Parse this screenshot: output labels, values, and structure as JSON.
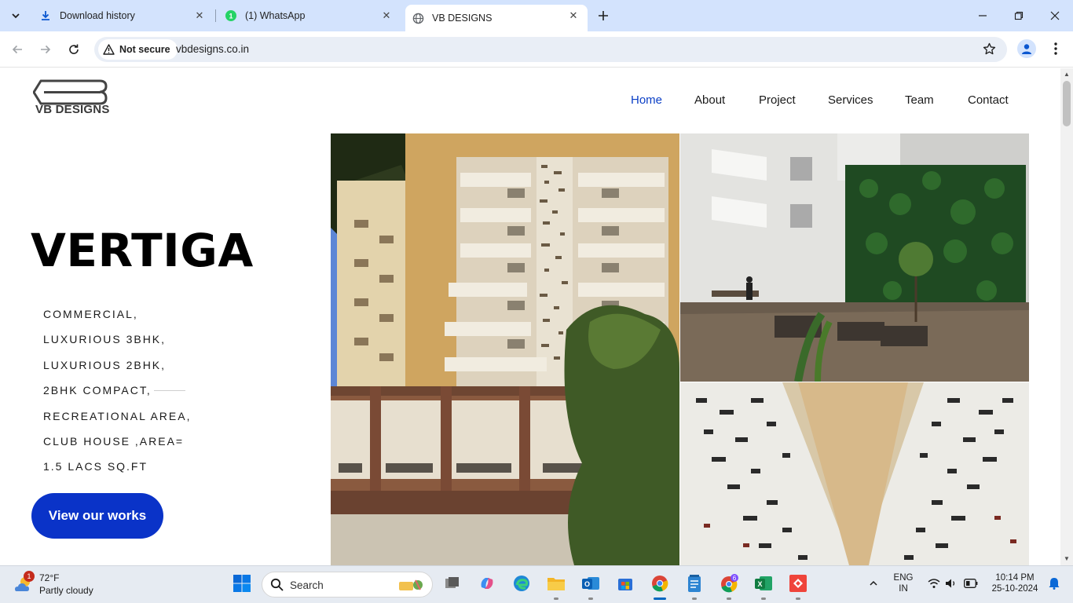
{
  "browser": {
    "tabs": [
      {
        "title": "Download history",
        "icon": "download-icon"
      },
      {
        "title": "(1) WhatsApp",
        "icon": "whatsapp-icon"
      },
      {
        "title": "VB DESIGNS",
        "icon": "globe-icon",
        "active": true
      }
    ],
    "security_label": "Not secure",
    "url": "vbdesigns.co.in"
  },
  "site": {
    "logo_text": "VB DESIGNS",
    "nav": [
      "Home",
      "About",
      "Project",
      "Services",
      "Team",
      "Contact"
    ],
    "active_nav": "Home",
    "accent_color": "#0a33c8",
    "hero": {
      "title": "VERTIGA",
      "lines": [
        "COMMERCIAL,",
        "LUXURIOUS 3BHK,",
        "LUXURIOUS 2BHK,",
        "2BHK COMPACT,",
        "RECREATIONAL AREA,",
        "CLUB HOUSE ,AREA=",
        "1.5 LACS SQ.FT"
      ],
      "cta": "View our works"
    }
  },
  "taskbar": {
    "weather": {
      "temp": "72°F",
      "condition": "Partly cloudy",
      "badge": "1"
    },
    "search_placeholder": "Search",
    "language": {
      "line1": "ENG",
      "line2": "IN"
    },
    "clock": {
      "time": "10:14 PM",
      "date": "25-10-2024"
    },
    "chrome_badge": "6"
  }
}
